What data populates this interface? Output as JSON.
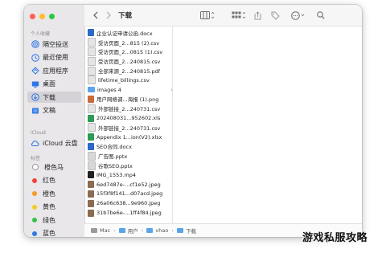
{
  "window": {
    "title": "下载"
  },
  "sidebar": {
    "favorites_header": "个人收藏",
    "favorites": [
      {
        "label": "隔空投送",
        "icon": "airdrop-icon"
      },
      {
        "label": "最近使用",
        "icon": "clock-icon"
      },
      {
        "label": "应用程序",
        "icon": "apps-icon"
      },
      {
        "label": "桌面",
        "icon": "desktop-icon"
      },
      {
        "label": "下载",
        "icon": "download-icon",
        "selected": true
      },
      {
        "label": "文稿",
        "icon": "document-icon"
      }
    ],
    "icloud_header": "iCloud",
    "icloud": [
      {
        "label": "iCloud 云盘",
        "icon": "cloud-icon"
      }
    ],
    "tags_header": "标签",
    "tags": [
      {
        "label": "橙色马",
        "color": "#ffffff"
      },
      {
        "label": "红色",
        "color": "#f0443a"
      },
      {
        "label": "橙色",
        "color": "#f59a23"
      },
      {
        "label": "黄色",
        "color": "#f5cb23"
      },
      {
        "label": "绿色",
        "color": "#35c04a"
      },
      {
        "label": "蓝色",
        "color": "#2f77e6"
      }
    ]
  },
  "files": [
    {
      "name": "企业认证申请公函.docx",
      "type": "docx"
    },
    {
      "name": "受访页面_2...815 (2).csv",
      "type": "csv"
    },
    {
      "name": "受访页面_2...0815 (1).csv",
      "type": "csv"
    },
    {
      "name": "受访页面_2...240815.csv",
      "type": "csv"
    },
    {
      "name": "全部来源_2...240815.pdf",
      "type": "pdf"
    },
    {
      "name": "lifetime_billings.csv",
      "type": "csv"
    },
    {
      "name": "images 4",
      "type": "folder",
      "has_children": true
    },
    {
      "name": "用户网络调...海报 (1).png",
      "type": "png"
    },
    {
      "name": "外部链接_2...240731.csv",
      "type": "csv"
    },
    {
      "name": "202408031...952602.xls",
      "type": "xls"
    },
    {
      "name": "外部链接_2...240731.csv",
      "type": "csv"
    },
    {
      "name": "Appendix 1...ion(V2).xlsx",
      "type": "xls"
    },
    {
      "name": "SEO合同.docx",
      "type": "docx"
    },
    {
      "name": "广告图.pptx",
      "type": "pptx"
    },
    {
      "name": "谷歌SEO.pptx",
      "type": "pptx"
    },
    {
      "name": "IMG_1553.mp4",
      "type": "mp4"
    },
    {
      "name": "6ed7487e-...cf1e52.jpeg",
      "type": "jpeg"
    },
    {
      "name": "15f3f8f141...d07acd.jpeg",
      "type": "jpeg"
    },
    {
      "name": "26a06c638...9e960.jpeg",
      "type": "jpeg"
    },
    {
      "name": "31b7be6e-...1ff4f84.jpeg",
      "type": "jpeg"
    }
  ],
  "pathbar": [
    "Mac",
    "用户",
    "vhao",
    "下载"
  ],
  "watermark": "游戏私服攻略",
  "colors": {
    "accent": "#2f77e6",
    "docx": "#2b68c9",
    "csv": "#e4e4e4",
    "pdf": "#e4e4e4",
    "xls": "#2f9a55",
    "pptx": "#d8d8d8",
    "png": "#c86a3a",
    "mp4": "#222222",
    "jpeg": "#8a6b52",
    "folder": "#5aa4ea"
  }
}
